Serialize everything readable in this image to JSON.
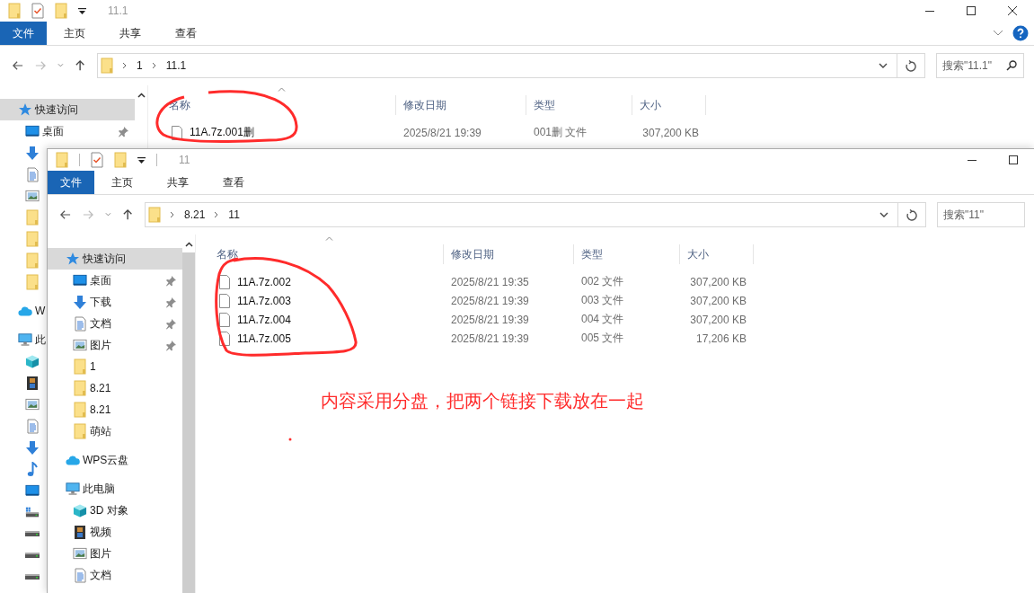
{
  "windows": [
    {
      "title": "11.1",
      "ribbon_tabs": [
        {
          "label": "文件",
          "selected": true
        },
        {
          "label": "主页",
          "selected": false
        },
        {
          "label": "共享",
          "selected": false
        },
        {
          "label": "查看",
          "selected": false
        }
      ],
      "address": [
        "1",
        "11.1"
      ],
      "search": {
        "placeholder": "搜索\"11.1\""
      },
      "nav": [
        {
          "kind": "star",
          "label": "快速访问",
          "selected": true,
          "children": [
            {
              "kind": "desktop",
              "label": "桌面",
              "pinned": true,
              "selected": false
            },
            {
              "kind": "download",
              "selected": false
            },
            {
              "kind": "document",
              "selected": false
            },
            {
              "kind": "picture",
              "selected": false
            },
            {
              "kind": "folder",
              "selected": false
            },
            {
              "kind": "folder",
              "selected": false
            },
            {
              "kind": "folder",
              "selected": false
            },
            {
              "kind": "folder",
              "selected": false
            }
          ]
        },
        {
          "kind": "cloud",
          "label": "W",
          "selected": false
        },
        {
          "kind": "pc",
          "label": "此",
          "selected": false,
          "children": [
            {
              "kind": "cube",
              "selected": false
            },
            {
              "kind": "video",
              "selected": false
            },
            {
              "kind": "picture",
              "selected": false
            },
            {
              "kind": "document",
              "selected": false
            },
            {
              "kind": "download",
              "selected": false
            },
            {
              "kind": "music",
              "selected": false
            },
            {
              "kind": "desktop",
              "selected": false
            },
            {
              "kind": "windrive",
              "selected": false
            },
            {
              "kind": "drive",
              "selected": false
            },
            {
              "kind": "drive",
              "selected": false
            },
            {
              "kind": "drive",
              "selected": false
            }
          ]
        }
      ],
      "columns": [
        "名称",
        "修改日期",
        "类型",
        "大小"
      ],
      "files": [
        {
          "name": "11A.7z.001删",
          "date": "2025/8/21 19:39",
          "type": "001删 文件",
          "size": "307,200 KB"
        }
      ]
    },
    {
      "title": "11",
      "ribbon_tabs": [
        {
          "label": "文件",
          "selected": true
        },
        {
          "label": "主页",
          "selected": false
        },
        {
          "label": "共享",
          "selected": false
        },
        {
          "label": "查看",
          "selected": false
        }
      ],
      "address": [
        "8.21",
        "11"
      ],
      "search": {
        "placeholder": "搜索\"11\""
      },
      "nav": [
        {
          "kind": "star",
          "label": "快速访问",
          "selected": true,
          "children": [
            {
              "kind": "desktop",
              "label": "桌面",
              "pinned": true,
              "selected": false
            },
            {
              "kind": "download",
              "label": "下载",
              "pinned": true,
              "selected": false
            },
            {
              "kind": "document",
              "label": "文档",
              "pinned": true,
              "selected": false
            },
            {
              "kind": "picture",
              "label": "图片",
              "pinned": true,
              "selected": false
            },
            {
              "kind": "folder",
              "label": "1",
              "selected": false
            },
            {
              "kind": "folder",
              "label": "8.21",
              "selected": false
            },
            {
              "kind": "folder",
              "label": "8.21",
              "selected": false
            },
            {
              "kind": "folder",
              "label": "萌站",
              "selected": false
            }
          ]
        },
        {
          "kind": "cloud",
          "label": "WPS云盘",
          "selected": false
        },
        {
          "kind": "pc",
          "label": "此电脑",
          "selected": false,
          "children": [
            {
              "kind": "cube",
              "label": "3D 对象",
              "selected": false
            },
            {
              "kind": "video",
              "label": "视频",
              "selected": false
            },
            {
              "kind": "picture",
              "label": "图片",
              "selected": false
            },
            {
              "kind": "document",
              "label": "文档",
              "selected": false
            }
          ]
        }
      ],
      "columns": [
        "名称",
        "修改日期",
        "类型",
        "大小"
      ],
      "files": [
        {
          "name": "11A.7z.002",
          "date": "2025/8/21 19:35",
          "type": "002 文件",
          "size": "307,200 KB"
        },
        {
          "name": "11A.7z.003",
          "date": "2025/8/21 19:39",
          "type": "003 文件",
          "size": "307,200 KB"
        },
        {
          "name": "11A.7z.004",
          "date": "2025/8/21 19:39",
          "type": "004 文件",
          "size": "307,200 KB"
        },
        {
          "name": "11A.7z.005",
          "date": "2025/8/21 19:39",
          "type": "005 文件",
          "size": "17,206 KB"
        }
      ]
    }
  ],
  "annotation": {
    "note": "内容采用分盘，把两个链接下载放在一起"
  }
}
